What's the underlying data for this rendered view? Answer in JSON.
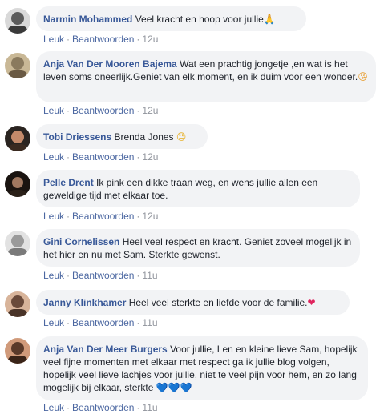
{
  "comments": [
    {
      "author": "Narmin Mohammed",
      "text": "Veel kracht en hoop voor jullie",
      "emoji": "🙏",
      "emoji_name": "praying-hands-icon",
      "like_label": "Leuk",
      "reply_label": "Beantwoorden",
      "time": "12u",
      "avatar_colors": [
        "#5b5b5b",
        "#d9d9d9"
      ]
    },
    {
      "author": "Anja Van Der Mooren Bajema",
      "text": "Wat een prachtig jongetje ,en wat is het leven soms oneerlijk.Geniet van elk moment, en ik duim voor een wonder.",
      "emoji": "😘",
      "emoji_name": "kiss-face-icon",
      "like_label": "Leuk",
      "reply_label": "Beantwoorden",
      "time": "12u",
      "avatar_colors": [
        "#8a7a5e",
        "#c9b896"
      ]
    },
    {
      "author": "Tobi Driessens",
      "text": "Brenda Jones",
      "emoji": "😓",
      "emoji_name": "sweat-face-icon",
      "like_label": "Leuk",
      "reply_label": "Beantwoorden",
      "time": "12u",
      "avatar_colors": [
        "#3a2a20",
        "#c48a6a"
      ]
    },
    {
      "author": "Pelle Drent",
      "text": "Ik pink een dikke traan weg, en wens jullie allen een geweldige tijd met elkaar toe.",
      "emoji": "",
      "emoji_name": "",
      "like_label": "Leuk",
      "reply_label": "Beantwoorden",
      "time": "12u",
      "avatar_colors": [
        "#1a1410",
        "#a07860"
      ]
    },
    {
      "author": "Gini Cornelissen",
      "text": "Heel veel respect en kracht. Geniet zoveel mogelijk in het hier en nu met Sam. Sterkte gewenst.",
      "emoji": "",
      "emoji_name": "",
      "like_label": "Leuk",
      "reply_label": "Beantwoorden",
      "time": "11u",
      "avatar_colors": [
        "#9a9a9a",
        "#e2e2e2"
      ]
    },
    {
      "author": "Janny Klinkhamer",
      "text": "Heel veel sterkte en liefde voor de familie.",
      "emoji": "❤",
      "emoji_name": "red-heart-icon",
      "like_label": "Leuk",
      "reply_label": "Beantwoorden",
      "time": "11u",
      "avatar_colors": [
        "#6a4a3a",
        "#d8b49a"
      ]
    },
    {
      "author": "Anja Van Der Meer Burgers",
      "text": "Voor jullie, Len en kleine lieve Sam, hopelijk veel fijne momenten met elkaar met respect ga ik jullie blog volgen, hopelijk veel lieve lachjes voor jullie, niet te veel pijn voor hem, en zo lang mogelijk bij elkaar, sterkte",
      "emoji": "💙💙💙",
      "emoji_name": "blue-hearts-icon",
      "like_label": "Leuk",
      "reply_label": "Beantwoorden",
      "time": "11u",
      "avatar_colors": [
        "#5a3a2a",
        "#d09a7a"
      ]
    }
  ]
}
